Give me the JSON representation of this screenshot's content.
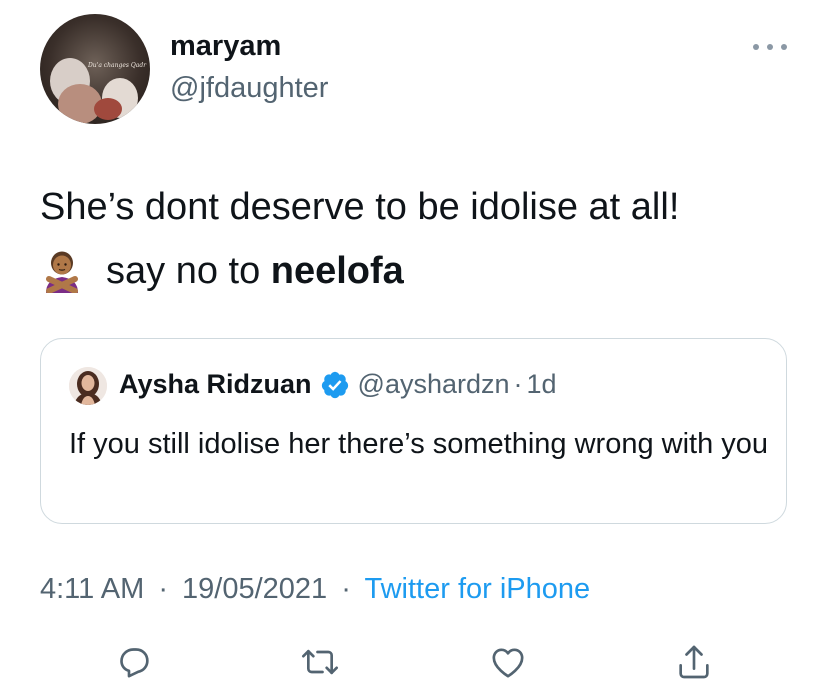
{
  "tweet": {
    "author": {
      "display_name": "maryam",
      "handle": "@jfdaughter",
      "avatar_caption": "Du'a changes Qadr"
    },
    "text_line1": "She’s dont deserve to be idolise at all!",
    "text_line2_prefix": "say no to ",
    "text_line2_strong": "neelofa",
    "emoji": "person-gesturing-no",
    "quoted": {
      "display_name": "Aysha Ridzuan",
      "verified": true,
      "handle": "@ayshardzn",
      "separator": "·",
      "age": "1d",
      "text": "If you still idolise her there’s something wrong with you"
    },
    "time": "4:11 AM",
    "sep1": "·",
    "date": "19/05/2021",
    "sep2": "·",
    "source": "Twitter for iPhone"
  },
  "actions": [
    "reply-icon",
    "retweet-icon",
    "like-icon",
    "share-icon"
  ],
  "colors": {
    "text": "#0f1419",
    "secondary": "#536471",
    "accent": "#1d9bf0",
    "border": "#cfd9de"
  }
}
